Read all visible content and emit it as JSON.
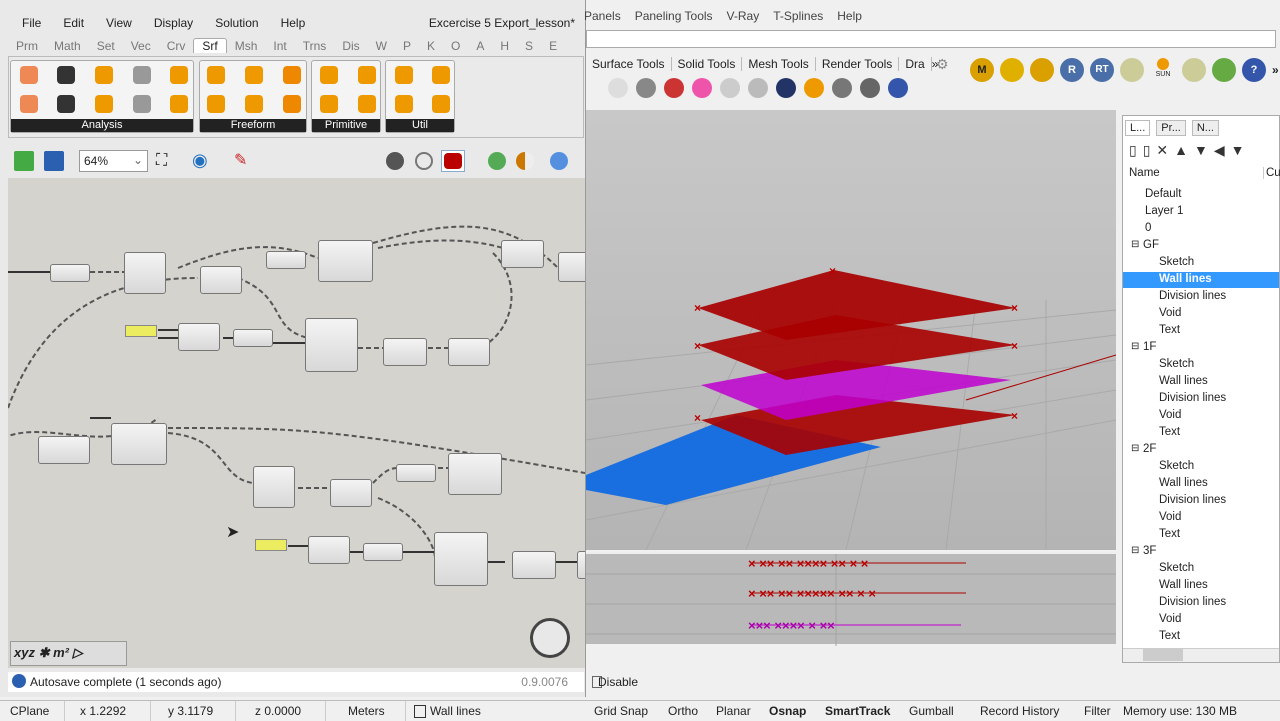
{
  "gh": {
    "menu": [
      "File",
      "Edit",
      "View",
      "Display",
      "Solution",
      "Help"
    ],
    "doc_title": "Excercise 5 Export_lesson*",
    "tabs": [
      "Prm",
      "Math",
      "Set",
      "Vec",
      "Crv",
      "Srf",
      "Msh",
      "Int",
      "Trns",
      "Dis",
      "W",
      "P",
      "K",
      "O",
      "A",
      "H",
      "S",
      "E"
    ],
    "active_tab": "Srf",
    "groups": [
      "Analysis",
      "Freeform",
      "Primitive",
      "Util"
    ],
    "zoom": "64%",
    "status": "Autosave complete (1 seconds ago)",
    "version": "0.9.0076"
  },
  "rhino": {
    "menu": [
      "Panels",
      "Paneling Tools",
      "V-Ray",
      "T-Splines",
      "Help"
    ],
    "toolbar_tabs": [
      "Surface Tools",
      "Solid Tools",
      "Mesh Tools",
      "Render Tools",
      "Dra"
    ],
    "right_icons": [
      "M",
      "RT",
      "R",
      "SUN"
    ],
    "disable_label": "Disable"
  },
  "layers": {
    "tabs": [
      "L...",
      "Pr...",
      "N..."
    ],
    "col_name": "Name",
    "col_current": "Cu",
    "items": [
      {
        "name": "Default",
        "level": 1
      },
      {
        "name": "Layer 1",
        "level": 1
      },
      {
        "name": "0",
        "level": 1
      },
      {
        "name": "GF",
        "level": 0
      },
      {
        "name": "Sketch",
        "level": 2
      },
      {
        "name": "Wall lines",
        "level": 2,
        "selected": true
      },
      {
        "name": "Division lines",
        "level": 2
      },
      {
        "name": "Void",
        "level": 2
      },
      {
        "name": "Text",
        "level": 2
      },
      {
        "name": "1F",
        "level": 0
      },
      {
        "name": "Sketch",
        "level": 2
      },
      {
        "name": "Wall lines",
        "level": 2
      },
      {
        "name": "Division lines",
        "level": 2
      },
      {
        "name": "Void",
        "level": 2
      },
      {
        "name": "Text",
        "level": 2
      },
      {
        "name": "2F",
        "level": 0
      },
      {
        "name": "Sketch",
        "level": 2
      },
      {
        "name": "Wall lines",
        "level": 2
      },
      {
        "name": "Division lines",
        "level": 2
      },
      {
        "name": "Void",
        "level": 2
      },
      {
        "name": "Text",
        "level": 2
      },
      {
        "name": "3F",
        "level": 0
      },
      {
        "name": "Sketch",
        "level": 2
      },
      {
        "name": "Wall lines",
        "level": 2
      },
      {
        "name": "Division lines",
        "level": 2
      },
      {
        "name": "Void",
        "level": 2
      },
      {
        "name": "Text",
        "level": 2
      }
    ]
  },
  "statusbar": {
    "cplane": "CPlane",
    "x": "x 1.2292",
    "y": "y 3.1179",
    "z": "z 0.0000",
    "units": "Meters",
    "layer": "Wall lines",
    "toggles": [
      "Grid Snap",
      "Ortho",
      "Planar",
      "Osnap",
      "SmartTrack",
      "Gumball",
      "Record History",
      "Filter"
    ],
    "memory": "Memory use: 130 MB"
  },
  "colors": {
    "accent": "#3399ff",
    "red": "#b00000",
    "magenta": "#c000d0",
    "blue": "#1a6fe0"
  }
}
